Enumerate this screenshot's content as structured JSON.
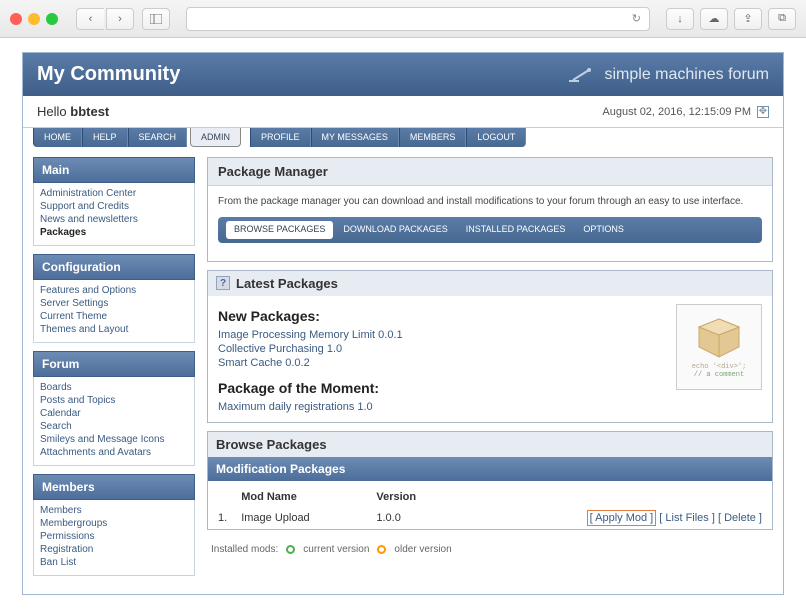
{
  "header": {
    "community": "My Community",
    "brand": "simple machines forum",
    "hello_prefix": "Hello",
    "username": "bbtest",
    "datetime": "August 02, 2016, 12:15:09 PM"
  },
  "main_menu": [
    "HOME",
    "HELP",
    "SEARCH",
    "ADMIN",
    "PROFILE",
    "MY MESSAGES",
    "MEMBERS",
    "LOGOUT"
  ],
  "main_menu_active": 3,
  "sidebar": {
    "sections": [
      {
        "title": "Main",
        "links": [
          "Administration Center",
          "Support and Credits",
          "News and newsletters",
          "Packages"
        ],
        "active": 3
      },
      {
        "title": "Configuration",
        "links": [
          "Features and Options",
          "Server Settings",
          "Current Theme",
          "Themes and Layout"
        ],
        "active": -1
      },
      {
        "title": "Forum",
        "links": [
          "Boards",
          "Posts and Topics",
          "Calendar",
          "Search",
          "Smileys and Message Icons",
          "Attachments and Avatars"
        ],
        "active": -1
      },
      {
        "title": "Members",
        "links": [
          "Members",
          "Membergroups",
          "Permissions",
          "Registration",
          "Ban List"
        ],
        "active": -1
      }
    ]
  },
  "package_manager": {
    "title": "Package Manager",
    "description": "From the package manager you can download and install modifications to your forum through an easy to use interface."
  },
  "sub_tabs": [
    "BROWSE PACKAGES",
    "DOWNLOAD PACKAGES",
    "INSTALLED PACKAGES",
    "OPTIONS"
  ],
  "sub_tabs_active": 0,
  "latest": {
    "title": "Latest Packages",
    "new_heading": "New Packages:",
    "new_items": [
      "Image Processing Memory Limit 0.0.1",
      "Collective Purchasing 1.0",
      "Smart Cache 0.0.2"
    ],
    "moment_heading": "Package of the Moment:",
    "moment_item": "Maximum daily registrations 1.0",
    "box_text1": "echo '<div>';",
    "box_text2": "// a comment"
  },
  "browse": {
    "title": "Browse Packages",
    "mod_title": "Modification Packages",
    "columns": {
      "name": "Mod Name",
      "version": "Version"
    },
    "rows": [
      {
        "num": "1.",
        "name": "Image Upload",
        "version": "1.0.0",
        "apply": "[ Apply Mod ]",
        "list": "[ List Files ]",
        "del": "[ Delete ]"
      }
    ],
    "legend_label": "Installed mods:",
    "legend_current": "current version",
    "legend_older": "older version"
  }
}
